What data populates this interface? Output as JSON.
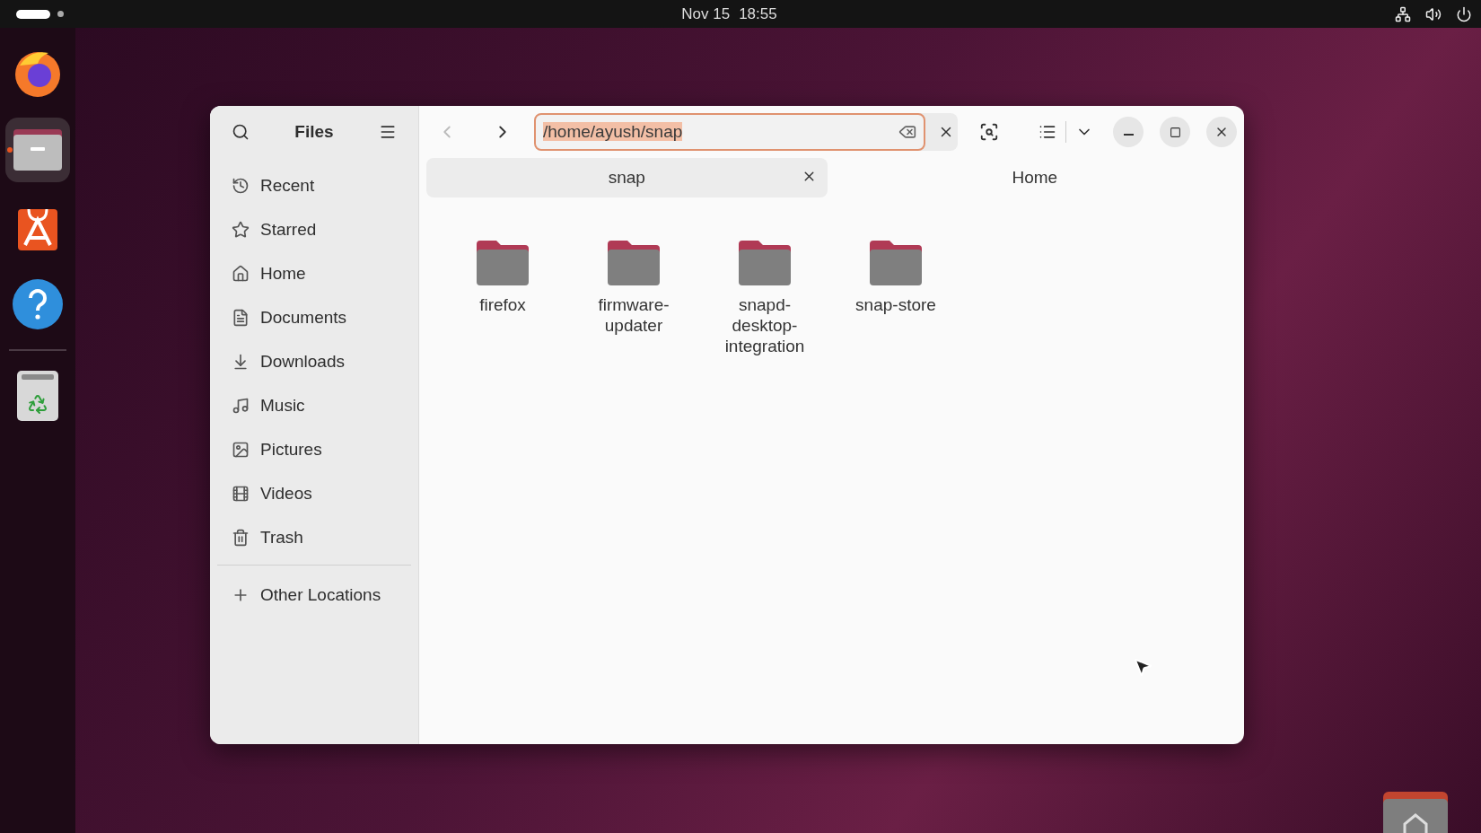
{
  "top_bar": {
    "date": "Nov 15",
    "time": "18:55"
  },
  "dock": {
    "items": [
      {
        "kind": "firefox",
        "running": false
      },
      {
        "kind": "files",
        "running": true
      },
      {
        "kind": "app-center",
        "running": false
      },
      {
        "kind": "help",
        "running": false
      },
      {
        "kind": "trash",
        "running": false
      }
    ]
  },
  "window": {
    "title": "Files",
    "sidebar": {
      "items": [
        {
          "kind": "recent",
          "label": "Recent"
        },
        {
          "kind": "starred",
          "label": "Starred"
        },
        {
          "kind": "home",
          "label": "Home"
        },
        {
          "kind": "documents",
          "label": "Documents"
        },
        {
          "kind": "downloads",
          "label": "Downloads"
        },
        {
          "kind": "music",
          "label": "Music"
        },
        {
          "kind": "pictures",
          "label": "Pictures"
        },
        {
          "kind": "videos",
          "label": "Videos"
        },
        {
          "kind": "trash",
          "label": "Trash"
        }
      ],
      "other": {
        "label": "Other Locations"
      }
    },
    "path_field": {
      "value": "/home/ayush/snap",
      "text_selected": true
    },
    "tabs": [
      {
        "label": "snap",
        "selected": true,
        "closable": true
      },
      {
        "label": "Home",
        "selected": false,
        "closable": false
      }
    ],
    "folders": [
      {
        "name": "firefox"
      },
      {
        "name": "firmware-\nupdater"
      },
      {
        "name": "snapd-\ndesktop-\nintegration"
      },
      {
        "name": "snap-store"
      }
    ]
  }
}
